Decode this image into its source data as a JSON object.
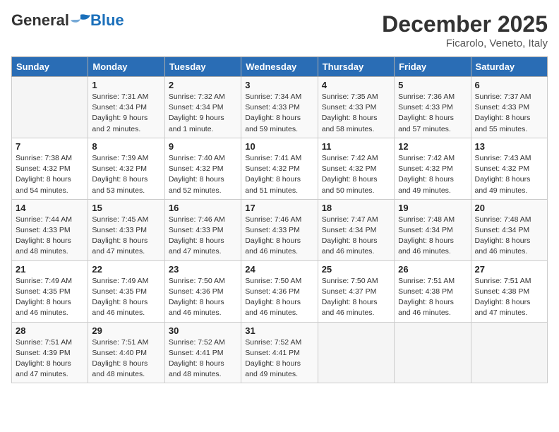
{
  "logo": {
    "general": "General",
    "blue": "Blue"
  },
  "header": {
    "month_title": "December 2025",
    "location": "Ficarolo, Veneto, Italy"
  },
  "days_of_week": [
    "Sunday",
    "Monday",
    "Tuesday",
    "Wednesday",
    "Thursday",
    "Friday",
    "Saturday"
  ],
  "weeks": [
    [
      {
        "day": "",
        "info": ""
      },
      {
        "day": "1",
        "info": "Sunrise: 7:31 AM\nSunset: 4:34 PM\nDaylight: 9 hours\nand 2 minutes."
      },
      {
        "day": "2",
        "info": "Sunrise: 7:32 AM\nSunset: 4:34 PM\nDaylight: 9 hours\nand 1 minute."
      },
      {
        "day": "3",
        "info": "Sunrise: 7:34 AM\nSunset: 4:33 PM\nDaylight: 8 hours\nand 59 minutes."
      },
      {
        "day": "4",
        "info": "Sunrise: 7:35 AM\nSunset: 4:33 PM\nDaylight: 8 hours\nand 58 minutes."
      },
      {
        "day": "5",
        "info": "Sunrise: 7:36 AM\nSunset: 4:33 PM\nDaylight: 8 hours\nand 57 minutes."
      },
      {
        "day": "6",
        "info": "Sunrise: 7:37 AM\nSunset: 4:33 PM\nDaylight: 8 hours\nand 55 minutes."
      }
    ],
    [
      {
        "day": "7",
        "info": "Sunrise: 7:38 AM\nSunset: 4:32 PM\nDaylight: 8 hours\nand 54 minutes."
      },
      {
        "day": "8",
        "info": "Sunrise: 7:39 AM\nSunset: 4:32 PM\nDaylight: 8 hours\nand 53 minutes."
      },
      {
        "day": "9",
        "info": "Sunrise: 7:40 AM\nSunset: 4:32 PM\nDaylight: 8 hours\nand 52 minutes."
      },
      {
        "day": "10",
        "info": "Sunrise: 7:41 AM\nSunset: 4:32 PM\nDaylight: 8 hours\nand 51 minutes."
      },
      {
        "day": "11",
        "info": "Sunrise: 7:42 AM\nSunset: 4:32 PM\nDaylight: 8 hours\nand 50 minutes."
      },
      {
        "day": "12",
        "info": "Sunrise: 7:42 AM\nSunset: 4:32 PM\nDaylight: 8 hours\nand 49 minutes."
      },
      {
        "day": "13",
        "info": "Sunrise: 7:43 AM\nSunset: 4:32 PM\nDaylight: 8 hours\nand 49 minutes."
      }
    ],
    [
      {
        "day": "14",
        "info": "Sunrise: 7:44 AM\nSunset: 4:33 PM\nDaylight: 8 hours\nand 48 minutes."
      },
      {
        "day": "15",
        "info": "Sunrise: 7:45 AM\nSunset: 4:33 PM\nDaylight: 8 hours\nand 47 minutes."
      },
      {
        "day": "16",
        "info": "Sunrise: 7:46 AM\nSunset: 4:33 PM\nDaylight: 8 hours\nand 47 minutes."
      },
      {
        "day": "17",
        "info": "Sunrise: 7:46 AM\nSunset: 4:33 PM\nDaylight: 8 hours\nand 46 minutes."
      },
      {
        "day": "18",
        "info": "Sunrise: 7:47 AM\nSunset: 4:34 PM\nDaylight: 8 hours\nand 46 minutes."
      },
      {
        "day": "19",
        "info": "Sunrise: 7:48 AM\nSunset: 4:34 PM\nDaylight: 8 hours\nand 46 minutes."
      },
      {
        "day": "20",
        "info": "Sunrise: 7:48 AM\nSunset: 4:34 PM\nDaylight: 8 hours\nand 46 minutes."
      }
    ],
    [
      {
        "day": "21",
        "info": "Sunrise: 7:49 AM\nSunset: 4:35 PM\nDaylight: 8 hours\nand 46 minutes."
      },
      {
        "day": "22",
        "info": "Sunrise: 7:49 AM\nSunset: 4:35 PM\nDaylight: 8 hours\nand 46 minutes."
      },
      {
        "day": "23",
        "info": "Sunrise: 7:50 AM\nSunset: 4:36 PM\nDaylight: 8 hours\nand 46 minutes."
      },
      {
        "day": "24",
        "info": "Sunrise: 7:50 AM\nSunset: 4:36 PM\nDaylight: 8 hours\nand 46 minutes."
      },
      {
        "day": "25",
        "info": "Sunrise: 7:50 AM\nSunset: 4:37 PM\nDaylight: 8 hours\nand 46 minutes."
      },
      {
        "day": "26",
        "info": "Sunrise: 7:51 AM\nSunset: 4:38 PM\nDaylight: 8 hours\nand 46 minutes."
      },
      {
        "day": "27",
        "info": "Sunrise: 7:51 AM\nSunset: 4:38 PM\nDaylight: 8 hours\nand 47 minutes."
      }
    ],
    [
      {
        "day": "28",
        "info": "Sunrise: 7:51 AM\nSunset: 4:39 PM\nDaylight: 8 hours\nand 47 minutes."
      },
      {
        "day": "29",
        "info": "Sunrise: 7:51 AM\nSunset: 4:40 PM\nDaylight: 8 hours\nand 48 minutes."
      },
      {
        "day": "30",
        "info": "Sunrise: 7:52 AM\nSunset: 4:41 PM\nDaylight: 8 hours\nand 48 minutes."
      },
      {
        "day": "31",
        "info": "Sunrise: 7:52 AM\nSunset: 4:41 PM\nDaylight: 8 hours\nand 49 minutes."
      },
      {
        "day": "",
        "info": ""
      },
      {
        "day": "",
        "info": ""
      },
      {
        "day": "",
        "info": ""
      }
    ]
  ]
}
